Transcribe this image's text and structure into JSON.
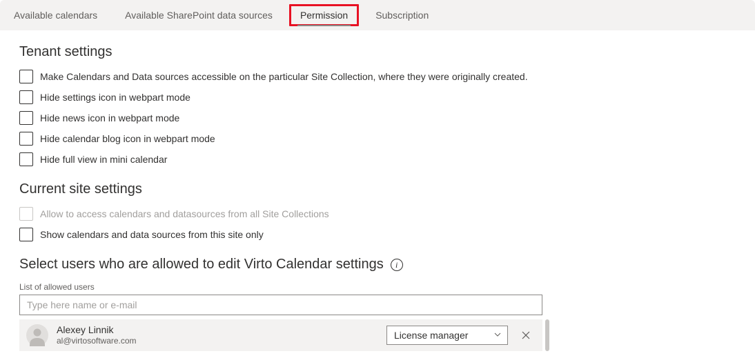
{
  "tabs": {
    "calendars": "Available calendars",
    "datasources": "Available SharePoint data sources",
    "permission": "Permission",
    "subscription": "Subscription"
  },
  "tenant": {
    "title": "Tenant settings",
    "check1": "Make Calendars and Data sources accessible on the particular Site Collection, where they were originally created.",
    "check2": "Hide settings icon in webpart mode",
    "check3": "Hide news icon in webpart mode",
    "check4": "Hide calendar blog icon in webpart mode",
    "check5": "Hide full view in mini calendar"
  },
  "site": {
    "title": "Current site settings",
    "check1": "Allow to access calendars and datasources from all Site Collections",
    "check2": "Show calendars and data sources from this site only"
  },
  "editors": {
    "heading": "Select users who are allowed to edit Virto Calendar settings",
    "label": "List of allowed users",
    "placeholder": "Type here name or e-mail"
  },
  "users": [
    {
      "name": "Alexey Linnik",
      "email": "al@virtosoftware.com",
      "role": "License manager"
    }
  ]
}
